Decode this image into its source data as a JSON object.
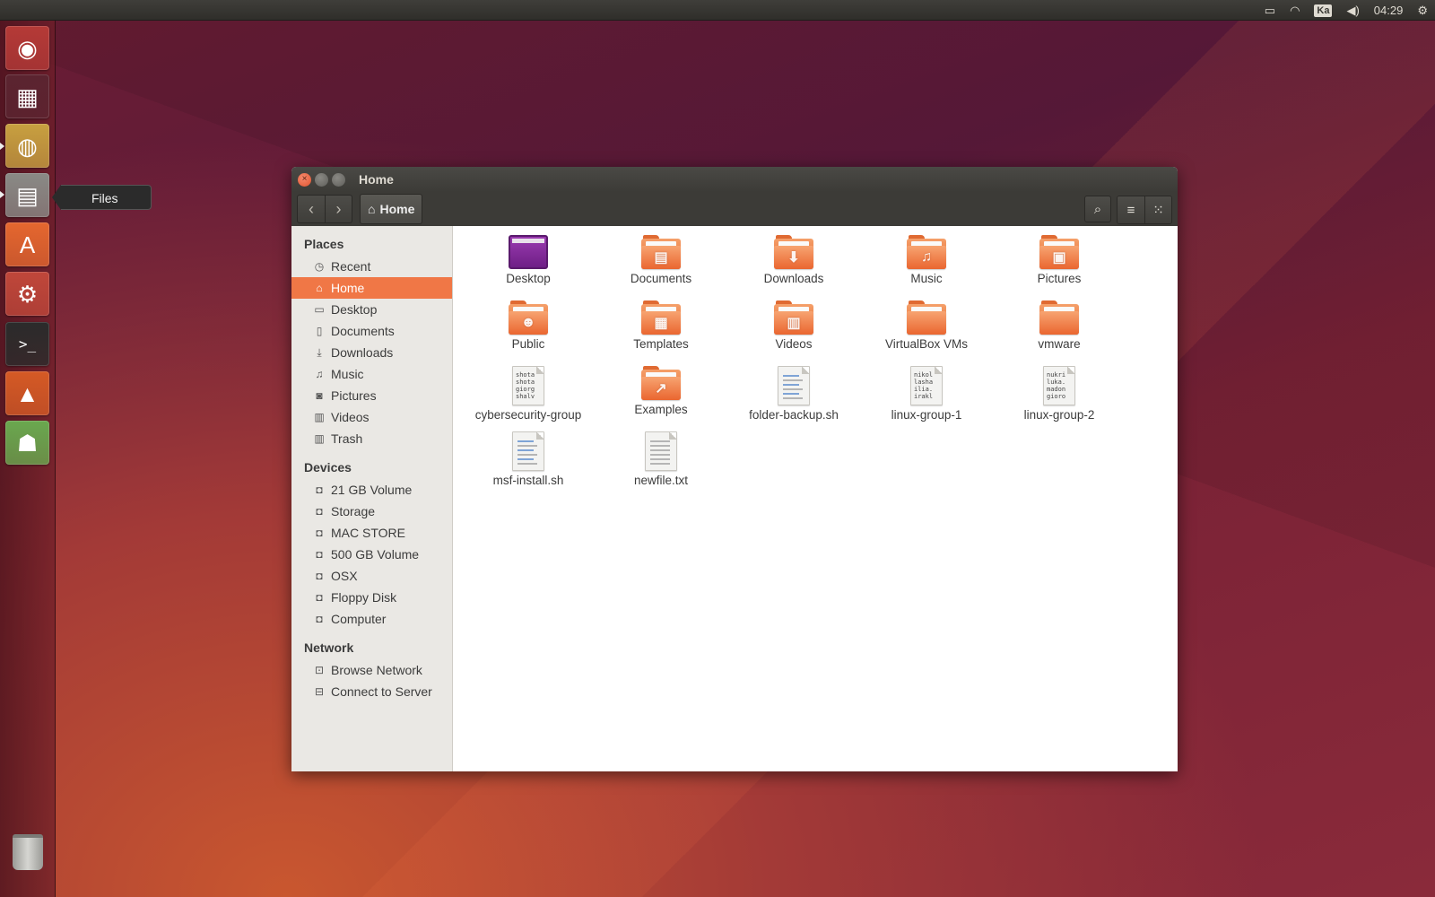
{
  "panel": {
    "clock": "04:29",
    "keyboard": "Ka"
  },
  "launcher": {
    "items": [
      {
        "name": "dash-button",
        "icon": "ubuntu-logo-icon",
        "glyph": "◉",
        "bg": "#b53a37"
      },
      {
        "name": "workspace-switcher-button",
        "icon": "workspace-switcher-icon",
        "glyph": "▦",
        "bg": "#5b2430"
      },
      {
        "name": "chrome-button",
        "icon": "chrome-icon",
        "glyph": "◍",
        "bg": "#c8a040"
      },
      {
        "name": "files-button",
        "icon": "files-cabinet-icon",
        "glyph": "▤",
        "bg": "#8a8a86"
      },
      {
        "name": "software-center-button",
        "icon": "software-center-icon",
        "glyph": "A",
        "bg": "#e5672f"
      },
      {
        "name": "system-settings-button",
        "icon": "system-settings-icon",
        "glyph": "⚙",
        "bg": "#c0473a"
      },
      {
        "name": "terminal-button",
        "icon": "terminal-icon",
        "glyph": ">_",
        "bg": "#2b2b2b"
      },
      {
        "name": "vlc-button",
        "icon": "vlc-icon",
        "glyph": "▲",
        "bg": "#d55a25"
      },
      {
        "name": "android-studio-button",
        "icon": "android-icon",
        "glyph": "☗",
        "bg": "#6aa84f"
      }
    ],
    "tooltip": "Files",
    "trash_icon": "trash-icon"
  },
  "window": {
    "title": "Home",
    "path_label": "Home"
  },
  "sidebar": {
    "places_label": "Places",
    "places": [
      {
        "label": "Recent",
        "icon": "clock-icon",
        "glyph": "◷"
      },
      {
        "label": "Home",
        "icon": "home-icon",
        "glyph": "⌂",
        "selected": true
      },
      {
        "label": "Desktop",
        "icon": "folder-icon",
        "glyph": "▭"
      },
      {
        "label": "Documents",
        "icon": "document-icon",
        "glyph": "▯"
      },
      {
        "label": "Downloads",
        "icon": "download-icon",
        "glyph": "⤓"
      },
      {
        "label": "Music",
        "icon": "music-icon",
        "glyph": "♫"
      },
      {
        "label": "Pictures",
        "icon": "camera-icon",
        "glyph": "◙"
      },
      {
        "label": "Videos",
        "icon": "film-icon",
        "glyph": "▥"
      },
      {
        "label": "Trash",
        "icon": "trash-icon",
        "glyph": "▥"
      }
    ],
    "devices_label": "Devices",
    "devices": [
      {
        "label": "21 GB Volume",
        "icon": "drive-icon"
      },
      {
        "label": "Storage",
        "icon": "drive-icon"
      },
      {
        "label": "MAC STORE",
        "icon": "drive-icon"
      },
      {
        "label": "500 GB Volume",
        "icon": "drive-icon"
      },
      {
        "label": "OSX",
        "icon": "drive-icon"
      },
      {
        "label": "Floppy Disk",
        "icon": "floppy-icon"
      },
      {
        "label": "Computer",
        "icon": "drive-icon"
      }
    ],
    "network_label": "Network",
    "network": [
      {
        "label": "Browse Network",
        "icon": "network-icon"
      },
      {
        "label": "Connect to Server",
        "icon": "server-icon"
      }
    ]
  },
  "files": [
    {
      "label": "Desktop",
      "type": "desktop"
    },
    {
      "label": "Documents",
      "type": "folder",
      "emblem": "▤"
    },
    {
      "label": "Downloads",
      "type": "folder",
      "emblem": "⬇"
    },
    {
      "label": "Music",
      "type": "folder",
      "emblem": "♫"
    },
    {
      "label": "Pictures",
      "type": "folder",
      "emblem": "▣"
    },
    {
      "label": "Public",
      "type": "folder",
      "emblem": "☻"
    },
    {
      "label": "Templates",
      "type": "folder",
      "emblem": "▦"
    },
    {
      "label": "Videos",
      "type": "folder",
      "emblem": "▥"
    },
    {
      "label": "VirtualBox VMs",
      "type": "folder",
      "emblem": ""
    },
    {
      "label": "vmware",
      "type": "folder",
      "emblem": ""
    },
    {
      "label": "cybersecurity-group",
      "type": "text",
      "preview": "shota\nshota\ngiorg\nshalv"
    },
    {
      "label": "Examples",
      "type": "folder",
      "emblem": "↗"
    },
    {
      "label": "folder-backup.sh",
      "type": "script"
    },
    {
      "label": "linux-group-1",
      "type": "text",
      "preview": "nikol\nlasha\nilia.\nirakl"
    },
    {
      "label": "linux-group-2",
      "type": "text",
      "preview": "nukri\nluka.\nmadon\ngioro"
    },
    {
      "label": "msf-install.sh",
      "type": "script"
    },
    {
      "label": "newfile.txt",
      "type": "plain"
    }
  ]
}
